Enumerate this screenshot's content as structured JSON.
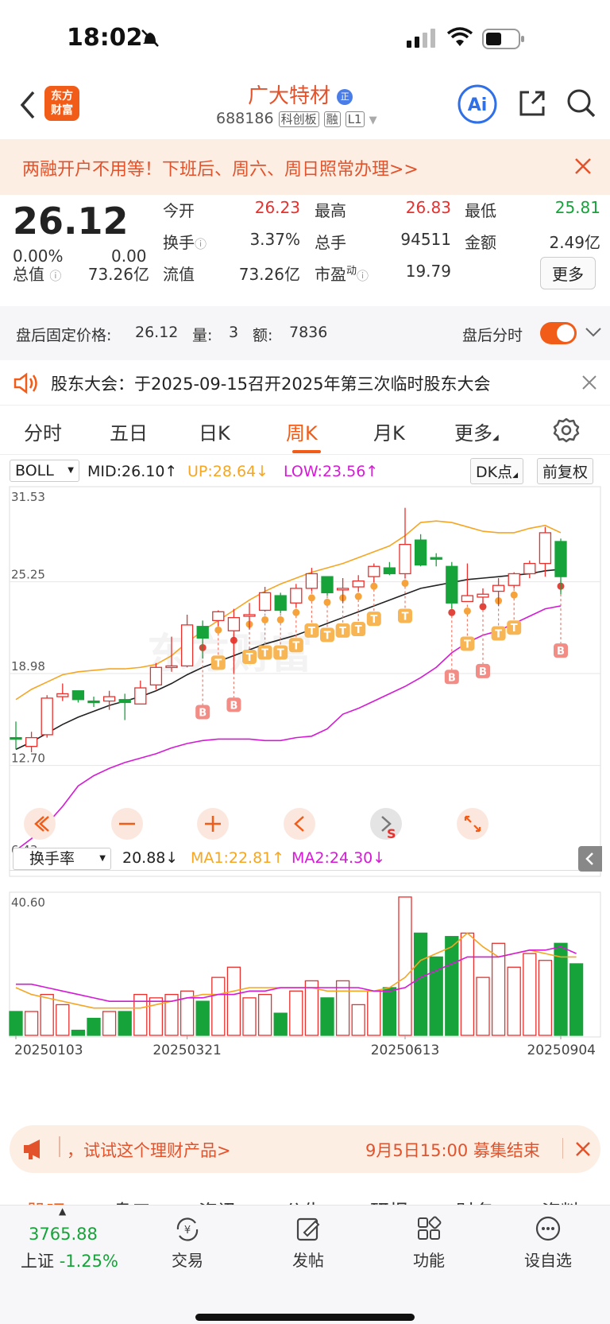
{
  "status": {
    "time": "18:02"
  },
  "nav": {
    "logo_line1": "东方",
    "logo_line2": "财富",
    "stock_name": "广大特材",
    "qualification_badge": "正",
    "code": "688186",
    "tags": [
      "科创板",
      "融",
      "L1"
    ]
  },
  "banner": {
    "text": "两融开户不用等！下班后、周六、周日照常办理>>"
  },
  "quote": {
    "price": "26.12",
    "change_pct": "0.00%",
    "change": "0.00",
    "open_label": "今开",
    "open": "26.23",
    "high_label": "最高",
    "high": "26.83",
    "low_label": "最低",
    "low": "25.81",
    "turnover_label": "换手",
    "turnover": "3.37%",
    "volume_label": "总手",
    "volume": "94511",
    "amount_label": "金额",
    "amount": "2.49亿",
    "total_mv_label": "总值",
    "total_mv": "73.26亿",
    "float_mv_label": "流值",
    "float_mv": "73.26亿",
    "pe_label": "市盈",
    "pe_sup": "动",
    "pe": "19.79",
    "more_label": "更多"
  },
  "after_hours": {
    "fixed_price_label": "盘后固定价格:",
    "fixed_price": "26.12",
    "qty_label": "量:",
    "qty": "3",
    "amt_label": "额:",
    "amt": "7836",
    "time_share_label": "盘后分时"
  },
  "notice": {
    "text": "股东大会：于2025-09-15召开2025年第三次临时股东大会"
  },
  "tabs": [
    {
      "label": "分时"
    },
    {
      "label": "五日"
    },
    {
      "label": "日K"
    },
    {
      "label": "周K"
    },
    {
      "label": "月K"
    },
    {
      "label": "更多"
    }
  ],
  "indicator": {
    "name": "BOLL",
    "mid": "MID:26.10↑",
    "up": "UP:28.64↓",
    "low": "LOW:23.56↑",
    "dk": "DK点",
    "adjust": "前复权"
  },
  "vol_indicator": {
    "name": "换手率",
    "value": "20.88↓",
    "ma1": "MA1:22.81↑",
    "ma2": "MA2:24.30↓"
  },
  "chart_data": {
    "type": "candlestick",
    "price_axis_labels": [
      "31.53",
      "25.25",
      "18.98",
      "12.70",
      "6.43"
    ],
    "price_ylim": [
      6.43,
      31.53
    ],
    "candles": [
      {
        "o": 14.6,
        "c": 14.5,
        "h": 15.7,
        "l": 13.8
      },
      {
        "o": 14.0,
        "c": 14.6,
        "h": 15.0,
        "l": 13.6
      },
      {
        "o": 14.8,
        "c": 17.3,
        "h": 17.5,
        "l": 14.6
      },
      {
        "o": 17.4,
        "c": 17.6,
        "h": 18.3,
        "l": 17.1
      },
      {
        "o": 17.8,
        "c": 17.2,
        "h": 17.8,
        "l": 17.0
      },
      {
        "o": 17.1,
        "c": 17.0,
        "h": 17.4,
        "l": 16.7
      },
      {
        "o": 17.1,
        "c": 17.4,
        "h": 17.8,
        "l": 16.5
      },
      {
        "o": 17.2,
        "c": 17.0,
        "h": 17.6,
        "l": 15.8
      },
      {
        "o": 16.9,
        "c": 18.0,
        "h": 18.5,
        "l": 16.9
      },
      {
        "o": 18.2,
        "c": 19.4,
        "h": 19.7,
        "l": 17.9
      },
      {
        "o": 19.4,
        "c": 19.5,
        "h": 21.5,
        "l": 19.1
      },
      {
        "o": 19.5,
        "c": 22.3,
        "h": 23.0,
        "l": 19.4
      },
      {
        "o": 22.2,
        "c": 21.4,
        "h": 22.6,
        "l": 20.0
      },
      {
        "o": 22.6,
        "c": 23.2,
        "h": 23.3,
        "l": 22.2
      },
      {
        "o": 21.9,
        "c": 22.8,
        "h": 23.4,
        "l": 19.0
      },
      {
        "o": 23.0,
        "c": 23.0,
        "h": 23.8,
        "l": 22.0
      },
      {
        "o": 23.3,
        "c": 24.5,
        "h": 24.9,
        "l": 23.2
      },
      {
        "o": 24.3,
        "c": 23.3,
        "h": 24.5,
        "l": 23.1
      },
      {
        "o": 23.8,
        "c": 24.8,
        "h": 25.1,
        "l": 23.5
      },
      {
        "o": 24.8,
        "c": 25.8,
        "h": 26.2,
        "l": 24.6
      },
      {
        "o": 25.6,
        "c": 24.5,
        "h": 25.6,
        "l": 24.3
      },
      {
        "o": 24.8,
        "c": 24.8,
        "h": 25.5,
        "l": 23.8
      },
      {
        "o": 24.9,
        "c": 25.3,
        "h": 25.7,
        "l": 24.6
      },
      {
        "o": 25.6,
        "c": 26.3,
        "h": 26.5,
        "l": 25.2
      },
      {
        "o": 26.2,
        "c": 25.8,
        "h": 26.6,
        "l": 25.7
      },
      {
        "o": 25.8,
        "c": 27.8,
        "h": 30.3,
        "l": 25.5
      },
      {
        "o": 28.1,
        "c": 26.4,
        "h": 28.5,
        "l": 26.3
      },
      {
        "o": 26.9,
        "c": 26.8,
        "h": 27.2,
        "l": 26.3
      },
      {
        "o": 26.3,
        "c": 23.8,
        "h": 26.6,
        "l": 23.4
      },
      {
        "o": 23.9,
        "c": 24.3,
        "h": 26.5,
        "l": 23.9
      },
      {
        "o": 24.2,
        "c": 24.4,
        "h": 24.8,
        "l": 23.8
      },
      {
        "o": 24.6,
        "c": 25.0,
        "h": 25.5,
        "l": 23.6
      },
      {
        "o": 25.0,
        "c": 25.8,
        "h": 25.9,
        "l": 24.8
      },
      {
        "o": 25.8,
        "c": 26.5,
        "h": 26.7,
        "l": 25.5
      },
      {
        "o": 26.5,
        "c": 28.6,
        "h": 29.0,
        "l": 25.6
      },
      {
        "o": 28.0,
        "c": 25.6,
        "h": 28.2,
        "l": 24.4
      }
    ],
    "boll_mid": [
      13.8,
      14.3,
      14.9,
      15.5,
      16.0,
      16.4,
      16.8,
      17.1,
      17.4,
      17.8,
      18.3,
      18.9,
      19.4,
      19.8,
      20.2,
      20.6,
      21.0,
      21.3,
      21.6,
      22.0,
      22.4,
      22.8,
      23.2,
      23.6,
      24.0,
      24.4,
      24.8,
      25.0,
      25.2,
      25.4,
      25.5,
      25.6,
      25.7,
      25.8,
      26.0,
      26.1
    ],
    "boll_up": [
      17.2,
      17.9,
      18.4,
      18.9,
      19.1,
      19.2,
      19.3,
      19.3,
      19.4,
      19.6,
      20.2,
      21.1,
      21.9,
      22.6,
      23.3,
      24.0,
      24.6,
      25.1,
      25.5,
      25.9,
      26.2,
      26.5,
      26.9,
      27.3,
      27.7,
      28.4,
      29.3,
      29.4,
      29.3,
      29.0,
      28.7,
      28.6,
      28.6,
      28.9,
      29.1,
      28.6
    ],
    "boll_low": [
      6.9,
      7.7,
      8.7,
      9.9,
      11.3,
      12.0,
      12.5,
      12.9,
      13.2,
      13.5,
      13.9,
      14.2,
      14.4,
      14.5,
      14.5,
      14.5,
      14.4,
      14.4,
      14.6,
      14.7,
      15.2,
      16.2,
      16.6,
      17.1,
      17.6,
      18.1,
      18.7,
      19.4,
      20.4,
      21.1,
      21.6,
      21.9,
      22.4,
      22.9,
      23.4,
      23.6
    ],
    "turnover_axis_label": "40.60",
    "turnover": [
      7,
      7,
      12,
      9,
      1.5,
      5,
      7,
      7,
      12,
      11,
      12,
      13,
      10,
      17,
      20,
      11,
      12,
      6.5,
      13,
      16,
      11,
      16,
      9,
      13,
      14,
      40.6,
      30,
      23,
      29,
      30,
      17,
      27,
      20,
      24,
      22,
      27,
      21
    ],
    "turnover_ma1": [
      14,
      12,
      11,
      10,
      9,
      8,
      8,
      8,
      8,
      9,
      10,
      11,
      12,
      12,
      13,
      14,
      14,
      14,
      14,
      14,
      13,
      13,
      13,
      13,
      14,
      17,
      22,
      24,
      26,
      30,
      26,
      23,
      24,
      25,
      24,
      23,
      23
    ],
    "turnover_ma2": [
      15,
      15,
      14,
      13,
      12,
      11,
      10,
      10,
      10,
      10,
      10,
      11,
      11,
      12,
      12,
      13,
      13,
      14,
      14,
      14,
      14,
      14,
      14,
      13,
      13,
      14,
      17,
      19,
      21,
      23,
      23,
      23,
      24,
      25,
      25,
      26,
      24
    ],
    "date_labels": [
      "20250103",
      "20250321",
      "20250613",
      "20250904"
    ],
    "signals": [
      {
        "i": 12,
        "type": "B"
      },
      {
        "i": 13,
        "type": "T"
      },
      {
        "i": 14,
        "type": "B"
      },
      {
        "i": 15,
        "type": "T"
      },
      {
        "i": 16,
        "type": "T"
      },
      {
        "i": 17,
        "type": "T"
      },
      {
        "i": 18,
        "type": "T"
      },
      {
        "i": 19,
        "type": "T"
      },
      {
        "i": 20,
        "type": "T"
      },
      {
        "i": 21,
        "type": "T"
      },
      {
        "i": 22,
        "type": "T"
      },
      {
        "i": 23,
        "type": "T"
      },
      {
        "i": 25,
        "type": "T"
      },
      {
        "i": 28,
        "type": "B"
      },
      {
        "i": 29,
        "type": "T"
      },
      {
        "i": 30,
        "type": "B"
      },
      {
        "i": 31,
        "type": "T"
      },
      {
        "i": 32,
        "type": "T"
      },
      {
        "i": 35,
        "type": "B"
      }
    ]
  },
  "ad": {
    "text": "，试试这个理财产品>",
    "deadline": "9月5日15:00 募集结束"
  },
  "subtabs": [
    "股吧",
    "盘口",
    "资讯",
    "公告",
    "研报",
    "财务",
    "资料"
  ],
  "bottom": {
    "index_value": "3765.88",
    "index_name": "上证",
    "index_change": "-1.25%",
    "items": [
      "交易",
      "发帖",
      "功能",
      "设自选"
    ]
  },
  "colors": {
    "rise": "#e9302d",
    "fall": "#16a33a",
    "accent": "#f25c19"
  }
}
